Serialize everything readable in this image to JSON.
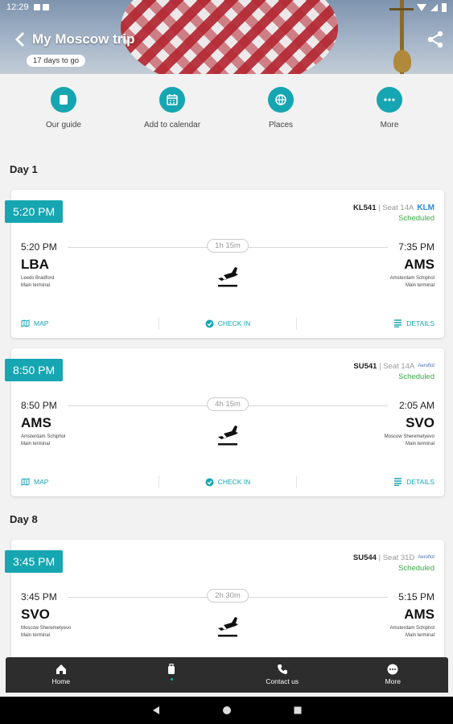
{
  "status_bar": {
    "time": "12:29"
  },
  "header": {
    "title": "My Moscow trip",
    "countdown": "17 days to go"
  },
  "quick_actions": [
    {
      "label": "Our guide",
      "icon": "square-icon"
    },
    {
      "label": "Add to calendar",
      "icon": "calendar-icon"
    },
    {
      "label": "Places",
      "icon": "globe-icon"
    },
    {
      "label": "More",
      "icon": "more-dots-icon"
    }
  ],
  "days": [
    {
      "label": "Day 1"
    },
    {
      "label": "Day 8"
    }
  ],
  "flights": [
    {
      "badge_time": "5:20 PM",
      "flight_no": "KL541",
      "seat": " | Seat 14A",
      "status": "Scheduled",
      "airline": "KLM",
      "dep_time": "5:20 PM",
      "dep_code": "LBA",
      "dep_airport": "Leeds Bradford",
      "dep_terminal": "Main terminal",
      "duration": "1h 15m",
      "arr_time": "7:35 PM",
      "arr_code": "AMS",
      "arr_airport": "Amsterdam Schiphol",
      "arr_terminal": "Main terminal",
      "map_label": "MAP",
      "checkin_label": "CHECK IN",
      "details_label": "DETAILS"
    },
    {
      "badge_time": "8:50 PM",
      "flight_no": "SU541",
      "seat": " | Seat 14A",
      "status": "Scheduled",
      "airline": "Aeroflot",
      "dep_time": "8:50 PM",
      "dep_code": "AMS",
      "dep_airport": "Amsterdam Schiphol",
      "dep_terminal": "Main terminal",
      "duration": "4h 15m",
      "arr_time": "2:05 AM",
      "arr_code": "SVO",
      "arr_airport": "Moscow Sheremetyevo",
      "arr_terminal": "Main terminal",
      "map_label": "MAP",
      "checkin_label": "CHECK IN",
      "details_label": "DETAILS"
    },
    {
      "badge_time": "3:45 PM",
      "flight_no": "SU544",
      "seat": " | Seat 31D",
      "status": "Scheduled",
      "airline": "Aeroflot",
      "dep_time": "3:45 PM",
      "dep_code": "SVO",
      "dep_airport": "Moscow Sheremetyevo",
      "dep_terminal": "Main terminal",
      "duration": "2h 30m",
      "arr_time": "5:15 PM",
      "arr_code": "AMS",
      "arr_airport": "Amsterdam Schiphol",
      "arr_terminal": "Main terminal"
    }
  ],
  "bottom_nav": [
    {
      "label": "Home",
      "icon": "home-icon"
    },
    {
      "label": "",
      "icon": "luggage-icon",
      "active": true
    },
    {
      "label": "Contact us",
      "icon": "phone-icon"
    },
    {
      "label": "More",
      "icon": "chat-more-icon"
    }
  ],
  "colors": {
    "accent": "#16a6b1",
    "status_green": "#3bab48",
    "nav_bg": "#2d2d2d"
  }
}
